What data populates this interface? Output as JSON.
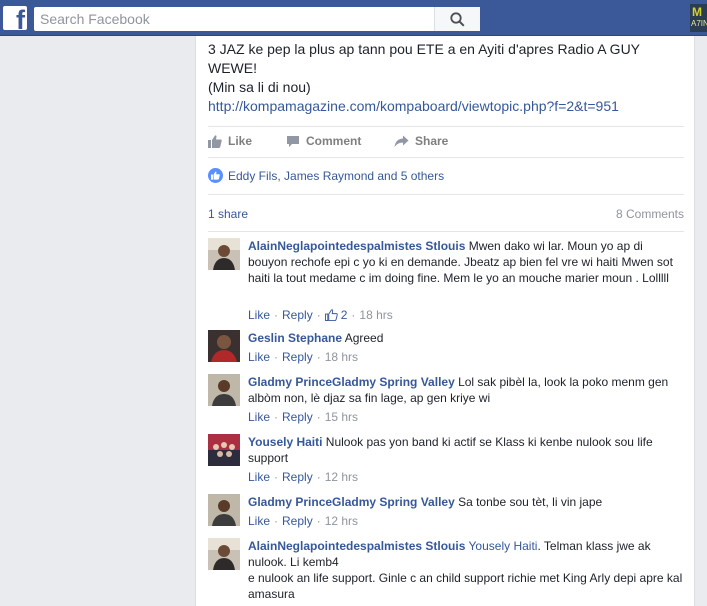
{
  "header": {
    "logo_letter": "f",
    "search_placeholder": "Search Facebook",
    "corner_thumb_top": "M",
    "corner_thumb_bottom": "A7IN"
  },
  "post": {
    "text_line1": "3 JAZ ke pep la plus ap tann pou ETE a en Ayiti d'apres Radio A GUY WEWE!",
    "text_line2": "(Min sa li di nou)",
    "link": "http://kompamagazine.com/kompaboard/viewtopic.php?f=2&t=951",
    "actions": {
      "like": "Like",
      "comment": "Comment",
      "share": "Share"
    },
    "likers": "Eddy Fils, James Raymond and 5 others",
    "shares": "1 share",
    "comments_count": "8 Comments"
  },
  "comments": [
    {
      "author": "AlainNeglapointedespalmistes Stlouis",
      "text": " Mwen dako wi lar. Moun yo ap di bouyon rechofe epi c yo ki en demande. Jbeatz ap bien fel vre wi haiti Mwen sot haiti la tout medame c im doing fine. Mem le yo an mouche marier moun . Lolllll",
      "like": "Like",
      "reply": "Reply",
      "reactions": "2",
      "time": "18 hrs"
    },
    {
      "author": "Geslin Stephane",
      "text": " Agreed",
      "like": "Like",
      "reply": "Reply",
      "time": "18 hrs"
    },
    {
      "author": "Gladmy PrinceGladmy Spring Valley",
      "text": " Lol sak pibèl la, look la poko menm gen albòm non, lè djaz sa fin lage, ap gen kriye wi",
      "like": "Like",
      "reply": "Reply",
      "time": "15 hrs"
    },
    {
      "author": "Yousely Haiti",
      "text": " Nulook pas yon band ki actif se Klass ki kenbe nulook sou life support",
      "like": "Like",
      "reply": "Reply",
      "time": "12 hrs"
    },
    {
      "author": "Gladmy PrinceGladmy Spring Valley",
      "text": " Sa tonbe sou tèt, li vin jape",
      "like": "Like",
      "reply": "Reply",
      "time": "12 hrs"
    },
    {
      "author": "AlainNeglapointedespalmistes Stlouis",
      "mention": "Yousely Haiti",
      "text_a": ". Telman klass jwe ak nulook. Li kemb4",
      "text_b": "e nulook an life support. Ginle c an child support richie met King Arly depi apre kal amasura"
    }
  ],
  "colors": {
    "header_blue": "#3b5998",
    "link_blue": "#365899",
    "meta_gray": "#90949c",
    "page_bg": "#e9ebee"
  },
  "icons": [
    "facebook-logo-icon",
    "search-icon",
    "like-thumb-icon",
    "comment-icon",
    "share-arrow-icon",
    "like-badge-icon"
  ]
}
